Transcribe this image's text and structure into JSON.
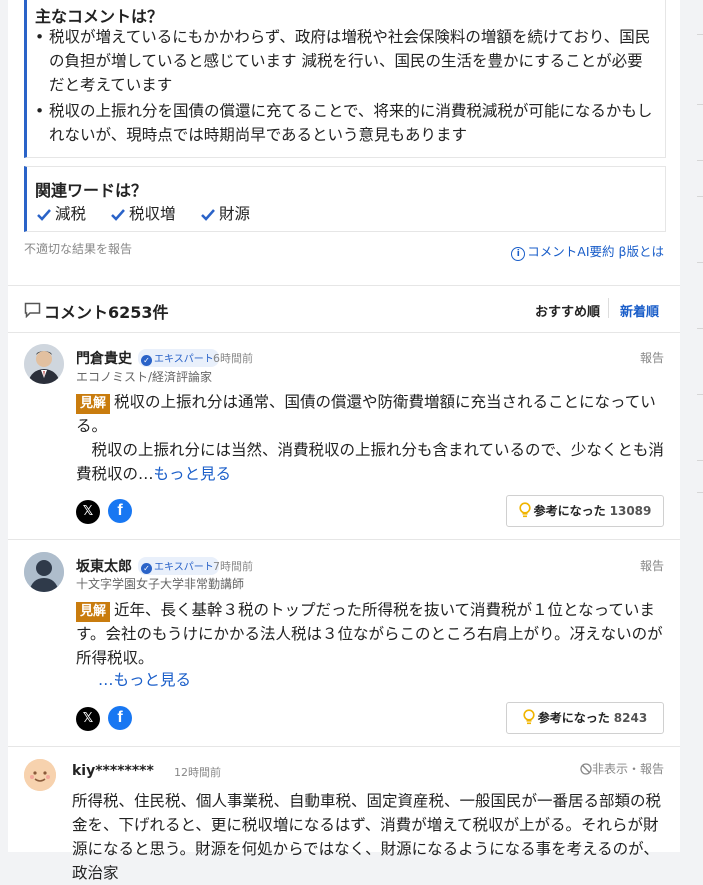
{
  "summary": {
    "title": "主なコメントは？",
    "bullets": [
      "税収が増えているにもかかわらず、政府は増税や社会保険料の増額を続けており、国民の負担が増していると感じています 減税を行い、国民の生活を豊かにすることが必要だと考えています",
      "税収の上振れ分を国債の償還に充てることで、将来的に消費税減税が可能になるかもしれないが、現時点では時期尚早であるという意見もあります"
    ]
  },
  "related": {
    "title": "関連ワードは？",
    "words": [
      "減税",
      "税収増",
      "財源"
    ]
  },
  "report_link": "不適切な結果を報告",
  "ai_link": "コメントAI要約 β版とは",
  "comments_header": {
    "title": "コメント6253件",
    "sort_recommended": "おすすめ順",
    "sort_newest": "新着順"
  },
  "comments": [
    {
      "name": "門倉貴史",
      "badge": "エキスパート",
      "time": "6時間前",
      "role": "エコノミスト/経済評論家",
      "report": "報告",
      "tag": "見解",
      "text1": "税収の上振れ分は通常、国債の償還や防衛費増額に充当されることになっている。",
      "text2": "　税収の上振れ分には当然、消費税収の上振れ分も含まれているので、少なくとも消費税収の…",
      "more": "もっと見る",
      "helpful_label": "参考になった",
      "helpful_count": "13089"
    },
    {
      "name": "坂東太郎",
      "badge": "エキスパート",
      "time": "7時間前",
      "role": "十文字学園女子大学非常勤講師",
      "report": "報告",
      "tag": "見解",
      "text1": "近年、長く基幹３税のトップだった所得税を抜いて消費税が１位となっています。会社のもうけにかかる法人税は３位ながらこのところ右肩上がり。冴えないのが所得税収。",
      "more": "…もっと見る",
      "helpful_label": "参考になった",
      "helpful_count": "8243"
    },
    {
      "name": "kiy********",
      "time": "12時間前",
      "report": "非表示・報告",
      "text1": "所得税、住民税、個人事業税、自動車税、固定資産税、一般国民が一番居る部類の税金を、下げれると、更に税収増になるはず、消費が増えて税収が上がる。それらが財源になると思う。財源を何処からではなく、財源になるようになる事を考えるのが、政治家"
    }
  ],
  "colors": {
    "accent": "#2a63c8",
    "tag": "#c97c0e",
    "bulb": "#f0b400"
  }
}
